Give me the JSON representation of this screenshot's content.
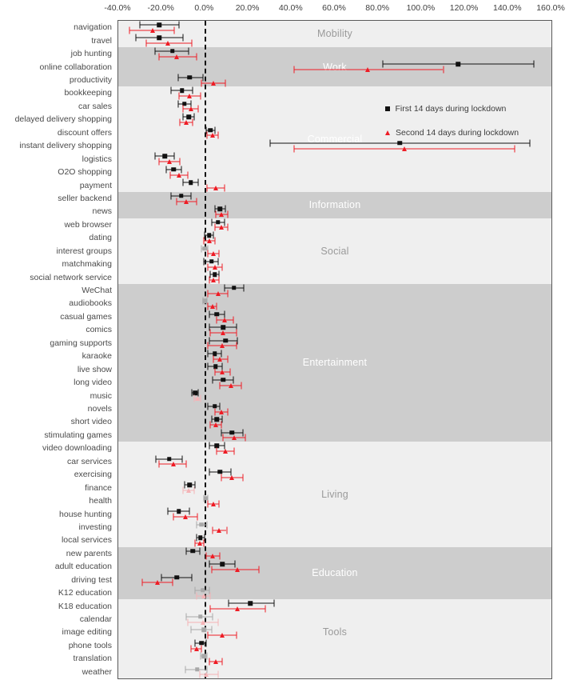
{
  "colors": {
    "series1": "#111111",
    "series2": "#ee1c25",
    "series1_faded": "#a8a8a8",
    "series2_faded": "#f5b3b6",
    "band_dark": "#cdcdcd",
    "band_light": "#efefef",
    "band_title": "#ffffff",
    "zeroline": "#111111",
    "frame": "#5a5a5a"
  },
  "legend": {
    "items": [
      {
        "marker": "square-marker",
        "label": "First 14 days during lockdown"
      },
      {
        "marker": "triangle-marker",
        "label": "Second 14 days during lockdown"
      }
    ]
  },
  "chart_data": {
    "type": "scatter",
    "title": "",
    "xlabel": "",
    "ylabel": "",
    "xlim": [
      -40,
      160
    ],
    "xticks": [
      -40,
      -20,
      0,
      20,
      40,
      60,
      80,
      100,
      120,
      140,
      160
    ],
    "xtick_labels": [
      "-40.0%",
      "-20.0%",
      "0.0%",
      "20.0%",
      "40.0%",
      "60.0%",
      "80.0%",
      "100.0%",
      "120.0%",
      "140.0%",
      "160.0%"
    ],
    "grid": false,
    "legend_position": "upper-center-right",
    "zero_reference_line": 0,
    "series": [
      {
        "name": "First 14 days during lockdown",
        "marker": "square",
        "color": "#111111"
      },
      {
        "name": "Second 14 days during lockdown",
        "marker": "triangle",
        "color": "#ee1c25"
      }
    ],
    "groups": [
      {
        "label": "Mobility",
        "title_color": "grey",
        "rows": 2
      },
      {
        "label": "Work",
        "title_color": "white",
        "rows": 3
      },
      {
        "label": "Commercial",
        "title_color": "white",
        "rows": 8
      },
      {
        "label": "Information",
        "title_color": "white",
        "rows": 2
      },
      {
        "label": "Social",
        "title_color": "grey",
        "rows": 5
      },
      {
        "label": "Entertainment",
        "title_color": "white",
        "rows": 12
      },
      {
        "label": "Living",
        "title_color": "grey",
        "rows": 8
      },
      {
        "label": "Education",
        "title_color": "white",
        "rows": 4
      },
      {
        "label": "Tools",
        "title_color": "grey",
        "rows": 5
      }
    ],
    "categories": [
      "navigation",
      "travel",
      "job hunting",
      "online collaboration",
      "productivity",
      "bookkeeping",
      "car sales",
      "delayed delivery shopping",
      "discount offers",
      "instant delivery shopping",
      "logistics",
      "O2O shopping",
      "payment",
      "seller backend",
      "news",
      "web browser",
      "dating",
      "interest groups",
      "matchmaking",
      "social network service",
      "WeChat",
      "audiobooks",
      "casual games",
      "comics",
      "gaming supports",
      "karaoke",
      "live show",
      "long video",
      "music",
      "novels",
      "short video",
      "stimulating games",
      "video downloading",
      "car services",
      "exercising",
      "finance",
      "health",
      "house hunting",
      "investing",
      "local services",
      "new parents",
      "adult education",
      "driving test",
      "K12 education",
      "K18 education",
      "calendar",
      "image editing",
      "phone tools",
      "translation",
      "weather"
    ],
    "points": [
      {
        "category": "navigation",
        "s1": {
          "est": -21.0,
          "lo": -30.0,
          "hi": -12.0,
          "faded": false
        },
        "s2": {
          "est": -24.0,
          "lo": -35.0,
          "hi": -14.0,
          "faded": false
        }
      },
      {
        "category": "travel",
        "s1": {
          "est": -21.0,
          "lo": -32.0,
          "hi": -10.0,
          "faded": false
        },
        "s2": {
          "est": -17.0,
          "lo": -27.0,
          "hi": -6.0,
          "faded": false
        }
      },
      {
        "category": "job hunting",
        "s1": {
          "est": -15.0,
          "lo": -23.0,
          "hi": -7.5,
          "faded": false
        },
        "s2": {
          "est": -13.0,
          "lo": -21.0,
          "hi": -4.0,
          "faded": false
        }
      },
      {
        "category": "online collaboration",
        "s1": {
          "est": 117.0,
          "lo": 82.0,
          "hi": 152.0,
          "faded": false
        },
        "s2": {
          "est": 75.0,
          "lo": 41.0,
          "hi": 110.0,
          "faded": false
        }
      },
      {
        "category": "productivity",
        "s1": {
          "est": -7.0,
          "lo": -12.5,
          "hi": -1.0,
          "faded": false
        },
        "s2": {
          "est": 4.0,
          "lo": -1.5,
          "hi": 9.5,
          "faded": false
        }
      },
      {
        "category": "bookkeeping",
        "s1": {
          "est": -10.5,
          "lo": -15.5,
          "hi": -5.5,
          "faded": false
        },
        "s2": {
          "est": -7.0,
          "lo": -12.0,
          "hi": -2.0,
          "faded": false
        }
      },
      {
        "category": "car sales",
        "s1": {
          "est": -9.5,
          "lo": -12.5,
          "hi": -6.5,
          "faded": false
        },
        "s2": {
          "est": -6.5,
          "lo": -10.0,
          "hi": -3.0,
          "faded": false
        }
      },
      {
        "category": "delayed delivery shopping",
        "s1": {
          "est": -7.5,
          "lo": -10.0,
          "hi": -5.0,
          "faded": false
        },
        "s2": {
          "est": -8.5,
          "lo": -11.5,
          "hi": -5.5,
          "faded": false
        }
      },
      {
        "category": "discount offers",
        "s1": {
          "est": 2.5,
          "lo": 0.5,
          "hi": 4.5,
          "faded": false
        },
        "s2": {
          "est": 3.5,
          "lo": 1.0,
          "hi": 6.0,
          "faded": false
        }
      },
      {
        "category": "instant delivery shopping",
        "s1": {
          "est": 90.0,
          "lo": 30.0,
          "hi": 150.0,
          "faded": false
        },
        "s2": {
          "est": 92.0,
          "lo": 41.0,
          "hi": 143.0,
          "faded": false
        }
      },
      {
        "category": "logistics",
        "s1": {
          "est": -18.5,
          "lo": -23.0,
          "hi": -14.0,
          "faded": false
        },
        "s2": {
          "est": -16.5,
          "lo": -21.0,
          "hi": -11.5,
          "faded": false
        }
      },
      {
        "category": "O2O shopping",
        "s1": {
          "est": -14.5,
          "lo": -18.0,
          "hi": -11.0,
          "faded": false
        },
        "s2": {
          "est": -12.0,
          "lo": -16.0,
          "hi": -8.0,
          "faded": false
        }
      },
      {
        "category": "payment",
        "s1": {
          "est": -6.5,
          "lo": -10.0,
          "hi": -3.0,
          "faded": false
        },
        "s2": {
          "est": 5.0,
          "lo": 1.0,
          "hi": 9.0,
          "faded": false
        }
      },
      {
        "category": "seller backend",
        "s1": {
          "est": -11.0,
          "lo": -15.5,
          "hi": -6.5,
          "faded": false
        },
        "s2": {
          "est": -8.5,
          "lo": -13.0,
          "hi": -4.0,
          "faded": false
        }
      },
      {
        "category": "news",
        "s1": {
          "est": 7.0,
          "lo": 4.5,
          "hi": 9.5,
          "faded": false
        },
        "s2": {
          "est": 7.5,
          "lo": 5.0,
          "hi": 10.5,
          "faded": false
        }
      },
      {
        "category": "web browser",
        "s1": {
          "est": 6.0,
          "lo": 3.0,
          "hi": 9.0,
          "faded": false
        },
        "s2": {
          "est": 7.5,
          "lo": 4.5,
          "hi": 10.5,
          "faded": false
        }
      },
      {
        "category": "dating",
        "s1": {
          "est": 2.0,
          "lo": 0.0,
          "hi": 4.0,
          "faded": false
        },
        "s2": {
          "est": 2.0,
          "lo": -0.5,
          "hi": 4.5,
          "faded": false
        }
      },
      {
        "category": "interest groups",
        "s1": {
          "est": 0.0,
          "lo": -1.5,
          "hi": 1.5,
          "faded": true
        },
        "s2": {
          "est": 4.0,
          "lo": 1.5,
          "hi": 6.5,
          "faded": false
        }
      },
      {
        "category": "matchmaking",
        "s1": {
          "est": 3.0,
          "lo": -0.5,
          "hi": 6.0,
          "faded": false
        },
        "s2": {
          "est": 4.5,
          "lo": 1.5,
          "hi": 8.0,
          "faded": false
        }
      },
      {
        "category": "social network service",
        "s1": {
          "est": 4.5,
          "lo": 2.5,
          "hi": 6.5,
          "faded": false
        },
        "s2": {
          "est": 4.0,
          "lo": 2.0,
          "hi": 6.5,
          "faded": false
        }
      },
      {
        "category": "WeChat",
        "s1": {
          "est": 13.5,
          "lo": 9.0,
          "hi": 18.0,
          "faded": false
        },
        "s2": {
          "est": 6.0,
          "lo": 1.5,
          "hi": 10.5,
          "faded": false
        }
      },
      {
        "category": "audiobooks",
        "s1": {
          "est": 0.0,
          "lo": -1.0,
          "hi": 1.0,
          "faded": true
        },
        "s2": {
          "est": 3.5,
          "lo": 1.5,
          "hi": 5.5,
          "faded": false
        }
      },
      {
        "category": "casual games",
        "s1": {
          "est": 5.5,
          "lo": 2.0,
          "hi": 9.0,
          "faded": false
        },
        "s2": {
          "est": 9.0,
          "lo": 5.5,
          "hi": 13.0,
          "faded": false
        }
      },
      {
        "category": "comics",
        "s1": {
          "est": 8.5,
          "lo": 2.0,
          "hi": 14.5,
          "faded": false
        },
        "s2": {
          "est": 8.5,
          "lo": 2.5,
          "hi": 14.5,
          "faded": false
        }
      },
      {
        "category": "gaming supports",
        "s1": {
          "est": 9.5,
          "lo": 2.0,
          "hi": 15.0,
          "faded": false
        },
        "s2": {
          "est": 8.0,
          "lo": 1.5,
          "hi": 14.5,
          "faded": false
        }
      },
      {
        "category": "karaoke",
        "s1": {
          "est": 4.5,
          "lo": 1.5,
          "hi": 7.5,
          "faded": false
        },
        "s2": {
          "est": 7.0,
          "lo": 4.0,
          "hi": 10.5,
          "faded": false
        }
      },
      {
        "category": "live show",
        "s1": {
          "est": 5.0,
          "lo": 1.5,
          "hi": 8.0,
          "faded": false
        },
        "s2": {
          "est": 8.0,
          "lo": 4.5,
          "hi": 11.5,
          "faded": false
        }
      },
      {
        "category": "long video",
        "s1": {
          "est": 8.5,
          "lo": 3.5,
          "hi": 13.0,
          "faded": false
        },
        "s2": {
          "est": 12.0,
          "lo": 7.0,
          "hi": 17.0,
          "faded": false
        }
      },
      {
        "category": "music",
        "s1": {
          "est": -4.5,
          "lo": -6.0,
          "hi": -3.0,
          "faded": false
        },
        "s2": {
          "est": -3.5,
          "lo": -5.0,
          "hi": -2.0,
          "faded": true
        }
      },
      {
        "category": "novels",
        "s1": {
          "est": 4.5,
          "lo": 1.5,
          "hi": 7.0,
          "faded": false
        },
        "s2": {
          "est": 7.5,
          "lo": 4.5,
          "hi": 10.5,
          "faded": false
        }
      },
      {
        "category": "short video",
        "s1": {
          "est": 5.5,
          "lo": 3.0,
          "hi": 8.0,
          "faded": false
        },
        "s2": {
          "est": 5.0,
          "lo": 2.5,
          "hi": 7.5,
          "faded": false
        }
      },
      {
        "category": "stimulating games",
        "s1": {
          "est": 12.5,
          "lo": 7.5,
          "hi": 17.5,
          "faded": false
        },
        "s2": {
          "est": 13.5,
          "lo": 8.5,
          "hi": 18.5,
          "faded": false
        }
      },
      {
        "category": "video downloading",
        "s1": {
          "est": 5.5,
          "lo": 2.0,
          "hi": 9.0,
          "faded": false
        },
        "s2": {
          "est": 9.5,
          "lo": 5.5,
          "hi": 13.5,
          "faded": false
        }
      },
      {
        "category": "car services",
        "s1": {
          "est": -16.5,
          "lo": -22.5,
          "hi": -10.5,
          "faded": false
        },
        "s2": {
          "est": -14.5,
          "lo": -21.0,
          "hi": -8.5,
          "faded": false
        }
      },
      {
        "category": "exercising",
        "s1": {
          "est": 7.0,
          "lo": 2.0,
          "hi": 12.0,
          "faded": false
        },
        "s2": {
          "est": 12.5,
          "lo": 7.5,
          "hi": 17.5,
          "faded": false
        }
      },
      {
        "category": "finance",
        "s1": {
          "est": -7.0,
          "lo": -9.5,
          "hi": -4.5,
          "faded": false
        },
        "s2": {
          "est": -7.5,
          "lo": -10.0,
          "hi": -5.0,
          "faded": true
        }
      },
      {
        "category": "health",
        "s1": {
          "est": 0.5,
          "lo": -0.5,
          "hi": 1.5,
          "faded": true
        },
        "s2": {
          "est": 4.0,
          "lo": 1.5,
          "hi": 6.5,
          "faded": false
        }
      },
      {
        "category": "house hunting",
        "s1": {
          "est": -12.0,
          "lo": -17.0,
          "hi": -7.0,
          "faded": false
        },
        "s2": {
          "est": -9.0,
          "lo": -14.5,
          "hi": -3.5,
          "faded": false
        }
      },
      {
        "category": "investing",
        "s1": {
          "est": -1.5,
          "lo": -4.0,
          "hi": 1.0,
          "faded": true
        },
        "s2": {
          "est": 6.5,
          "lo": 3.5,
          "hi": 10.0,
          "faded": false
        }
      },
      {
        "category": "local services",
        "s1": {
          "est": -2.0,
          "lo": -4.0,
          "hi": 0.0,
          "faded": false
        },
        "s2": {
          "est": -2.5,
          "lo": -4.5,
          "hi": -0.5,
          "faded": false
        }
      },
      {
        "category": "new parents",
        "s1": {
          "est": -5.5,
          "lo": -8.5,
          "hi": -2.5,
          "faded": false
        },
        "s2": {
          "est": 3.5,
          "lo": 0.5,
          "hi": 7.0,
          "faded": false
        }
      },
      {
        "category": "adult education",
        "s1": {
          "est": 8.0,
          "lo": 2.0,
          "hi": 14.0,
          "faded": false
        },
        "s2": {
          "est": 15.0,
          "lo": 3.0,
          "hi": 25.0,
          "faded": false
        }
      },
      {
        "category": "driving test",
        "s1": {
          "est": -13.0,
          "lo": -20.0,
          "hi": -6.0,
          "faded": false
        },
        "s2": {
          "est": -22.0,
          "lo": -29.0,
          "hi": -15.0,
          "faded": false
        }
      },
      {
        "category": "K12 education",
        "s1": {
          "est": -1.0,
          "lo": -4.5,
          "hi": 2.0,
          "faded": true
        },
        "s2": {
          "est": -0.5,
          "lo": -4.0,
          "hi": 2.5,
          "faded": true
        }
      },
      {
        "category": "K18 education",
        "s1": {
          "est": 21.0,
          "lo": 11.0,
          "hi": 32.0,
          "faded": false
        },
        "s2": {
          "est": 15.0,
          "lo": 2.5,
          "hi": 28.0,
          "faded": false
        }
      },
      {
        "category": "calendar",
        "s1": {
          "est": -2.0,
          "lo": -8.5,
          "hi": 3.5,
          "faded": true
        },
        "s2": {
          "est": -1.0,
          "lo": -8.0,
          "hi": 6.0,
          "faded": true
        }
      },
      {
        "category": "image editing",
        "s1": {
          "est": -0.5,
          "lo": -6.5,
          "hi": 3.0,
          "faded": true
        },
        "s2": {
          "est": 8.0,
          "lo": 1.5,
          "hi": 14.5,
          "faded": false
        }
      },
      {
        "category": "phone tools",
        "s1": {
          "est": -1.5,
          "lo": -4.5,
          "hi": 0.5,
          "faded": false
        },
        "s2": {
          "est": -4.0,
          "lo": -6.5,
          "hi": -1.5,
          "faded": false
        }
      },
      {
        "category": "translation",
        "s1": {
          "est": -0.5,
          "lo": -2.0,
          "hi": 1.0,
          "faded": true
        },
        "s2": {
          "est": 5.0,
          "lo": 2.0,
          "hi": 8.0,
          "faded": false
        }
      },
      {
        "category": "weather",
        "s1": {
          "est": -3.5,
          "lo": -9.0,
          "hi": 1.0,
          "faded": true
        },
        "s2": {
          "est": 0.5,
          "lo": -2.5,
          "hi": 6.0,
          "faded": true
        }
      }
    ]
  }
}
